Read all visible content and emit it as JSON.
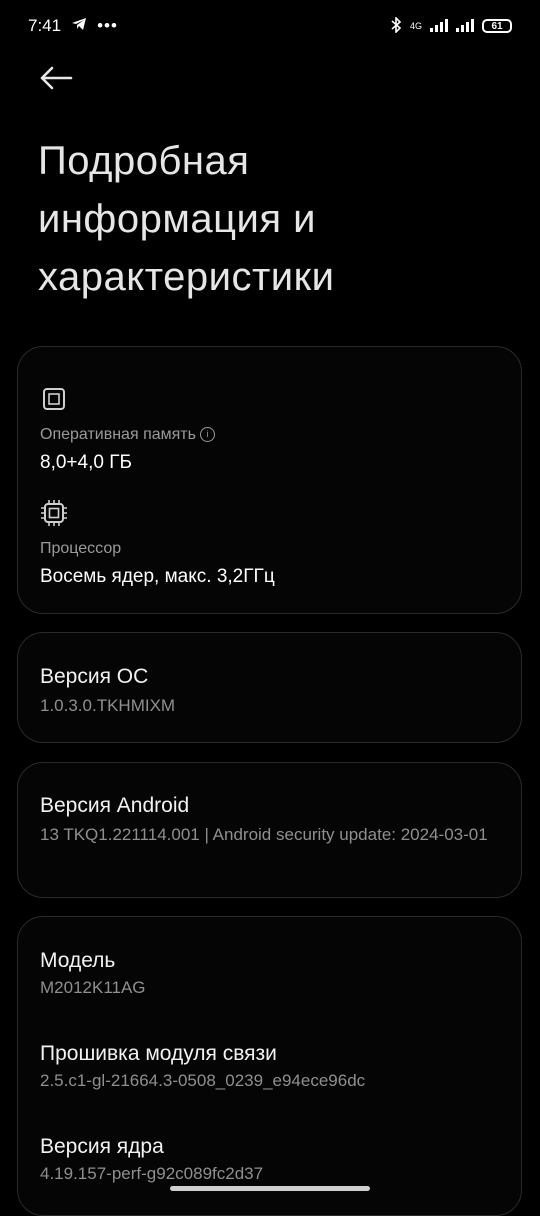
{
  "status": {
    "time": "7:41",
    "network": "4G",
    "battery": "61"
  },
  "page": {
    "title": "Подробная информация и характеристики"
  },
  "hardware": {
    "ram_label": "Оперативная память",
    "ram_value": "8,0+4,0 ГБ",
    "cpu_label": "Процессор",
    "cpu_value": "Восемь ядер, макс. 3,2ГГц"
  },
  "os": {
    "label": "Версия ОС",
    "value": "1.0.3.0.TKHMIXM"
  },
  "android": {
    "label": "Версия Android",
    "value": "13 TKQ1.221114.001 | Android security update: 2024-03-01"
  },
  "device": {
    "model_label": "Модель",
    "model_value": "M2012K11AG",
    "baseband_label": "Прошивка модуля связи",
    "baseband_value": "2.5.c1-gl-21664.3-0508_0239_e94ece96dc",
    "kernel_label": "Версия ядра",
    "kernel_value": "4.19.157-perf-g92c089fc2d37"
  },
  "icons": {
    "back": "arrow-left-icon",
    "chip": "chip-icon",
    "info": "info-icon"
  }
}
